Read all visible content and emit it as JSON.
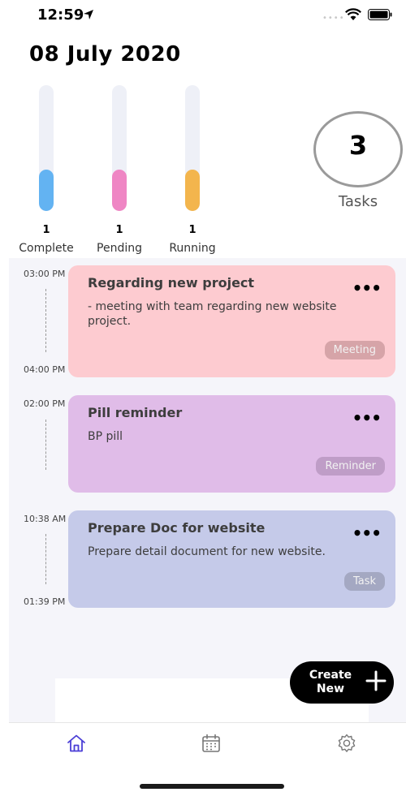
{
  "status_bar": {
    "time": "12:59"
  },
  "header": {
    "date": "08 July 2020"
  },
  "stats": [
    {
      "count": "1",
      "label": "Complete",
      "color": "#63b3f2",
      "level": 0.33
    },
    {
      "count": "1",
      "label": "Pending",
      "color": "#ef86c4",
      "level": 0.33
    },
    {
      "count": "1",
      "label": "Running",
      "color": "#f3b54d",
      "level": 0.33
    }
  ],
  "total": {
    "count": "3",
    "label": "Tasks"
  },
  "tasks": [
    {
      "start": "03:00 PM",
      "end": "04:00 PM",
      "title": "Regarding new project",
      "description": "- meeting with team regarding new website project.",
      "tag": "Meeting",
      "color": "#fdcbd0",
      "tag_color": "#d6a4a8"
    },
    {
      "start": "02:00 PM",
      "end": "",
      "title": "Pill reminder",
      "description": "BP pill",
      "tag": "Reminder",
      "color": "#e0bce8",
      "tag_color": "#bf9dc7"
    },
    {
      "start": "10:38 AM",
      "end": "01:39 PM",
      "title": "Prepare Doc for website",
      "description": "Prepare detail document for new website.",
      "tag": "Task",
      "color": "#c5cae9",
      "tag_color": "#a4a8c2"
    }
  ],
  "more_label": "•••",
  "fab": {
    "line1": "Create",
    "line2": "New"
  },
  "tabs": [
    {
      "icon": "home-icon",
      "color": "#4b3fd6"
    },
    {
      "icon": "calendar-icon",
      "color": "#777777"
    },
    {
      "icon": "gear-icon",
      "color": "#777777"
    }
  ]
}
